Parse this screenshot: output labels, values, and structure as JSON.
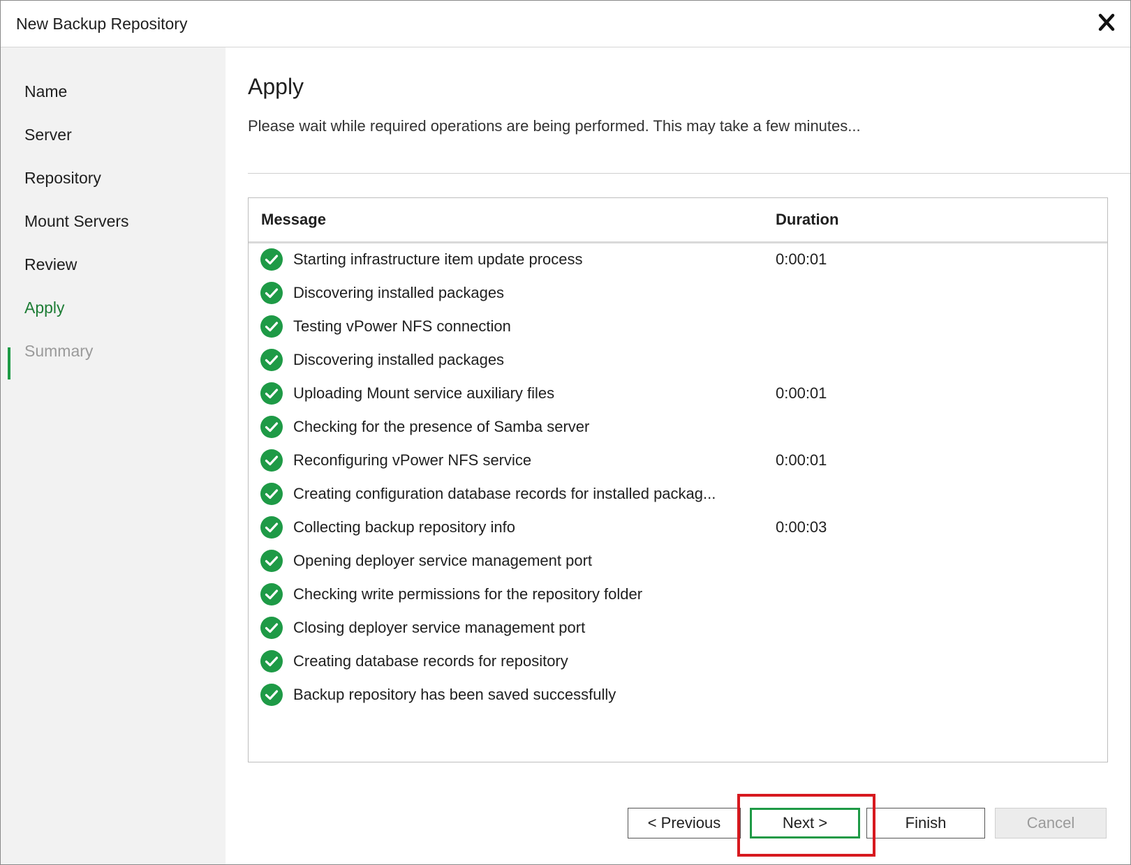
{
  "window": {
    "title": "New Backup Repository"
  },
  "sidebar": {
    "steps": [
      {
        "label": "Name",
        "state": "done"
      },
      {
        "label": "Server",
        "state": "done"
      },
      {
        "label": "Repository",
        "state": "done"
      },
      {
        "label": "Mount Servers",
        "state": "done"
      },
      {
        "label": "Review",
        "state": "done"
      },
      {
        "label": "Apply",
        "state": "active"
      },
      {
        "label": "Summary",
        "state": "disabled"
      }
    ]
  },
  "main": {
    "heading": "Apply",
    "subtitle": "Please wait while required operations are being performed. This may take a few minutes...",
    "table": {
      "columns": [
        "Message",
        "Duration"
      ],
      "rows": [
        {
          "message": "Starting infrastructure item update process",
          "duration": "0:00:01",
          "status": "success"
        },
        {
          "message": "Discovering installed packages",
          "duration": "",
          "status": "success"
        },
        {
          "message": "Testing vPower NFS connection",
          "duration": "",
          "status": "success"
        },
        {
          "message": "Discovering installed packages",
          "duration": "",
          "status": "success"
        },
        {
          "message": "Uploading Mount service auxiliary files",
          "duration": "0:00:01",
          "status": "success"
        },
        {
          "message": "Checking for the presence of Samba server",
          "duration": "",
          "status": "success"
        },
        {
          "message": "Reconfiguring vPower NFS service",
          "duration": "0:00:01",
          "status": "success"
        },
        {
          "message": "Creating configuration database records for installed packag...",
          "duration": "",
          "status": "success"
        },
        {
          "message": "Collecting backup repository info",
          "duration": "0:00:03",
          "status": "success"
        },
        {
          "message": "Opening deployer service management port",
          "duration": "",
          "status": "success"
        },
        {
          "message": "Checking write permissions for the repository folder",
          "duration": "",
          "status": "success"
        },
        {
          "message": "Closing deployer service management port",
          "duration": "",
          "status": "success"
        },
        {
          "message": "Creating database records for repository",
          "duration": "",
          "status": "success"
        },
        {
          "message": "Backup repository has been saved successfully",
          "duration": "",
          "status": "success"
        }
      ]
    }
  },
  "footer": {
    "previous_label": "< Previous",
    "next_label": "Next >",
    "finish_label": "Finish",
    "cancel_label": "Cancel"
  },
  "icons": {
    "close": "close-icon",
    "status": "check-circle-icon"
  },
  "colors": {
    "accent_green": "#1e9a46",
    "active_step": "#1e7d36",
    "highlight_red": "#d7191f"
  }
}
